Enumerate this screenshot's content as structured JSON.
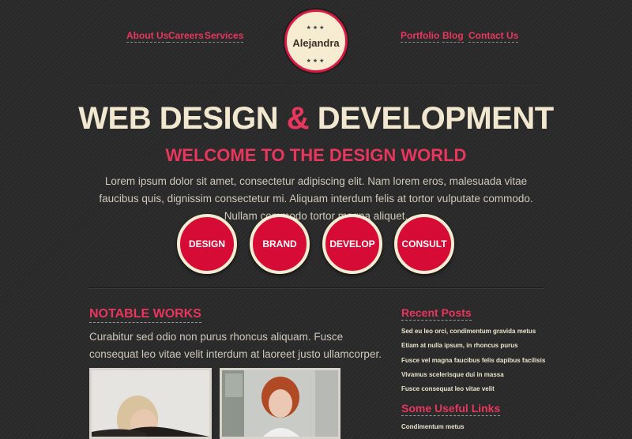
{
  "nav": {
    "left": [
      "About Us",
      "Careers",
      "Services"
    ],
    "right": [
      "Portfolio",
      "Blog",
      "Contact Us"
    ]
  },
  "logo": {
    "name": "Alejandra",
    "stars": "★★★"
  },
  "hero": {
    "title_part1": "WEB DESIGN ",
    "title_amp": "&",
    "title_part2": " DEVELOPMENT",
    "subtitle": "WELCOME TO THE DESIGN WORLD",
    "intro": "Lorem ipsum dolor sit amet, consectetur adipiscing elit. Nam lorem eros, malesuada vitae faucibus quis, dignissim consectetur mi. Aliquam interdum felis at tortor vulputate commodo. Nullam commodo tortor magna aliquet."
  },
  "services": [
    "DESIGN",
    "BRAND",
    "DEVELOP",
    "CONSULT"
  ],
  "works": {
    "title": "NOTABLE WORKS",
    "text": "Curabitur sed odio non purus rhoncus aliquam. Fusce consequat leo vitae velit interdum at laoreet justo ullamcorper."
  },
  "sidebar": {
    "recent_title": "Recent Posts",
    "posts": [
      "Sed eu leo orci, condimentum gravida metus",
      "Etiam at nulla ipsum, in rhoncus purus",
      "Fusce vel magna faucibus felis dapibus facilisis",
      "Vivamus scelerisque dui in massa",
      "Fusce consequat leo vitae velit"
    ],
    "links_title": "Some Useful Links",
    "links": [
      "Condimentum metus"
    ]
  },
  "colors": {
    "accent": "#e8365d",
    "button_red": "#d60b36",
    "cream": "#f2e8cf",
    "background": "#2a2a2b"
  }
}
